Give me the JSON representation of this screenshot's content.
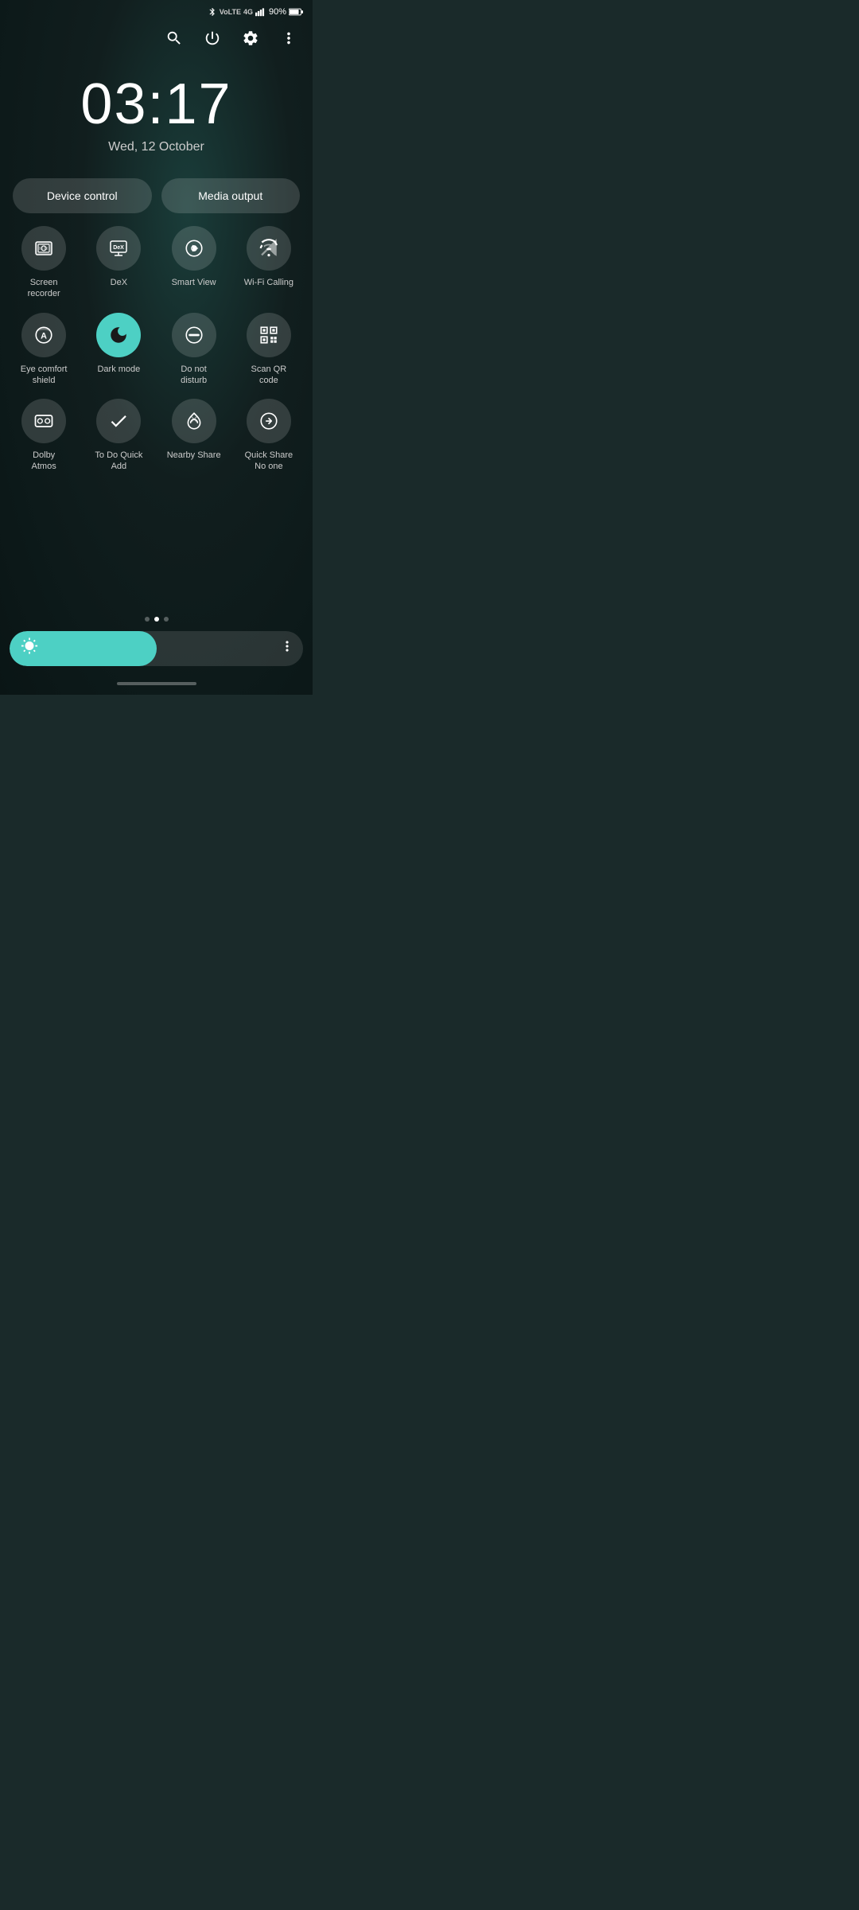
{
  "statusBar": {
    "battery": "90%",
    "signal": "4G",
    "bluetooth": "BT",
    "volte": "VoLTE"
  },
  "topControls": {
    "search": "search",
    "power": "power",
    "settings": "settings",
    "more": "more"
  },
  "clock": {
    "time": "03:17",
    "date": "Wed, 12 October"
  },
  "quickButtons": {
    "deviceControl": "Device control",
    "mediaOutput": "Media output"
  },
  "quickSettings": {
    "row1": [
      {
        "id": "screen-recorder",
        "label": "Screen\nrecorder",
        "active": false
      },
      {
        "id": "dex",
        "label": "DeX",
        "active": false
      },
      {
        "id": "smart-view",
        "label": "Smart View",
        "active": false
      },
      {
        "id": "wifi-calling",
        "label": "Wi-Fi Calling",
        "active": false
      }
    ],
    "row2": [
      {
        "id": "eye-comfort",
        "label": "Eye comfort\nshield",
        "active": false
      },
      {
        "id": "dark-mode",
        "label": "Dark mode",
        "active": true
      },
      {
        "id": "do-not-disturb",
        "label": "Do not\ndisturb",
        "active": false
      },
      {
        "id": "scan-qr",
        "label": "Scan QR\ncode",
        "active": false
      }
    ],
    "row3": [
      {
        "id": "dolby-atmos",
        "label": "Dolby\nAtmos",
        "active": false
      },
      {
        "id": "todo-quick-add",
        "label": "To Do Quick\nAdd",
        "active": false
      },
      {
        "id": "nearby-share",
        "label": "Nearby Share",
        "active": false
      },
      {
        "id": "quick-share",
        "label": "Quick Share\nNo one",
        "active": false
      }
    ]
  },
  "pageDots": [
    false,
    true,
    false
  ],
  "brightness": {
    "level": 50
  }
}
